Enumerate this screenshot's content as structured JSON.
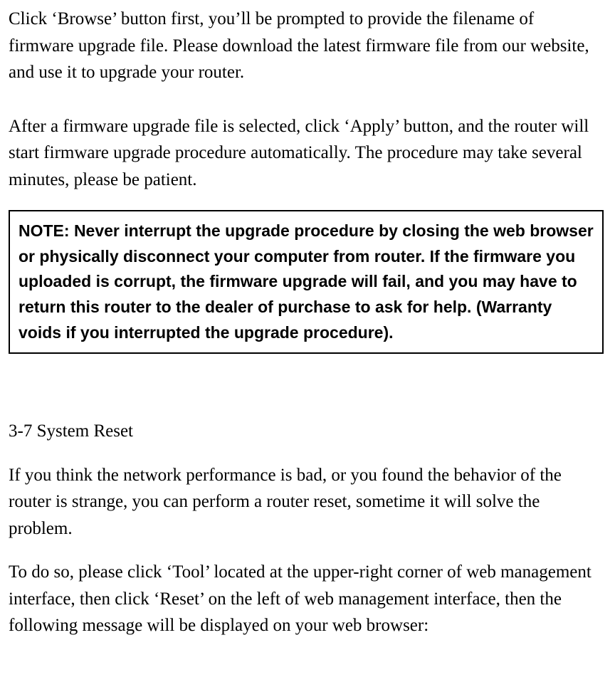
{
  "paragraphs": {
    "p1": "Click ‘Browse’ button first, you’ll be prompted to provide the filename of firmware upgrade file. Please download the latest firmware file from our website, and use it to upgrade your router.",
    "p2": "After a firmware upgrade file is selected, click ‘Apply’ button, and the router will start firmware upgrade procedure automatically. The procedure may take several minutes, please be patient.",
    "note": "NOTE: Never interrupt the upgrade procedure by closing the web browser or physically disconnect your computer from router. If the firmware you uploaded is corrupt, the firmware upgrade will fail, and you may have to return this router to the dealer of purchase to ask for help. (Warranty voids if you interrupted the upgrade procedure).",
    "heading": "3-7 System Reset",
    "p3": "If you think the network performance is bad, or you found the behavior of the router is strange, you can perform a router reset, sometime it will solve the problem.",
    "p4": "To do so, please click ‘Tool’ located at the upper-right corner of web management interface, then click ‘Reset’ on the left of web management interface, then the following message will be displayed on your web browser:"
  }
}
